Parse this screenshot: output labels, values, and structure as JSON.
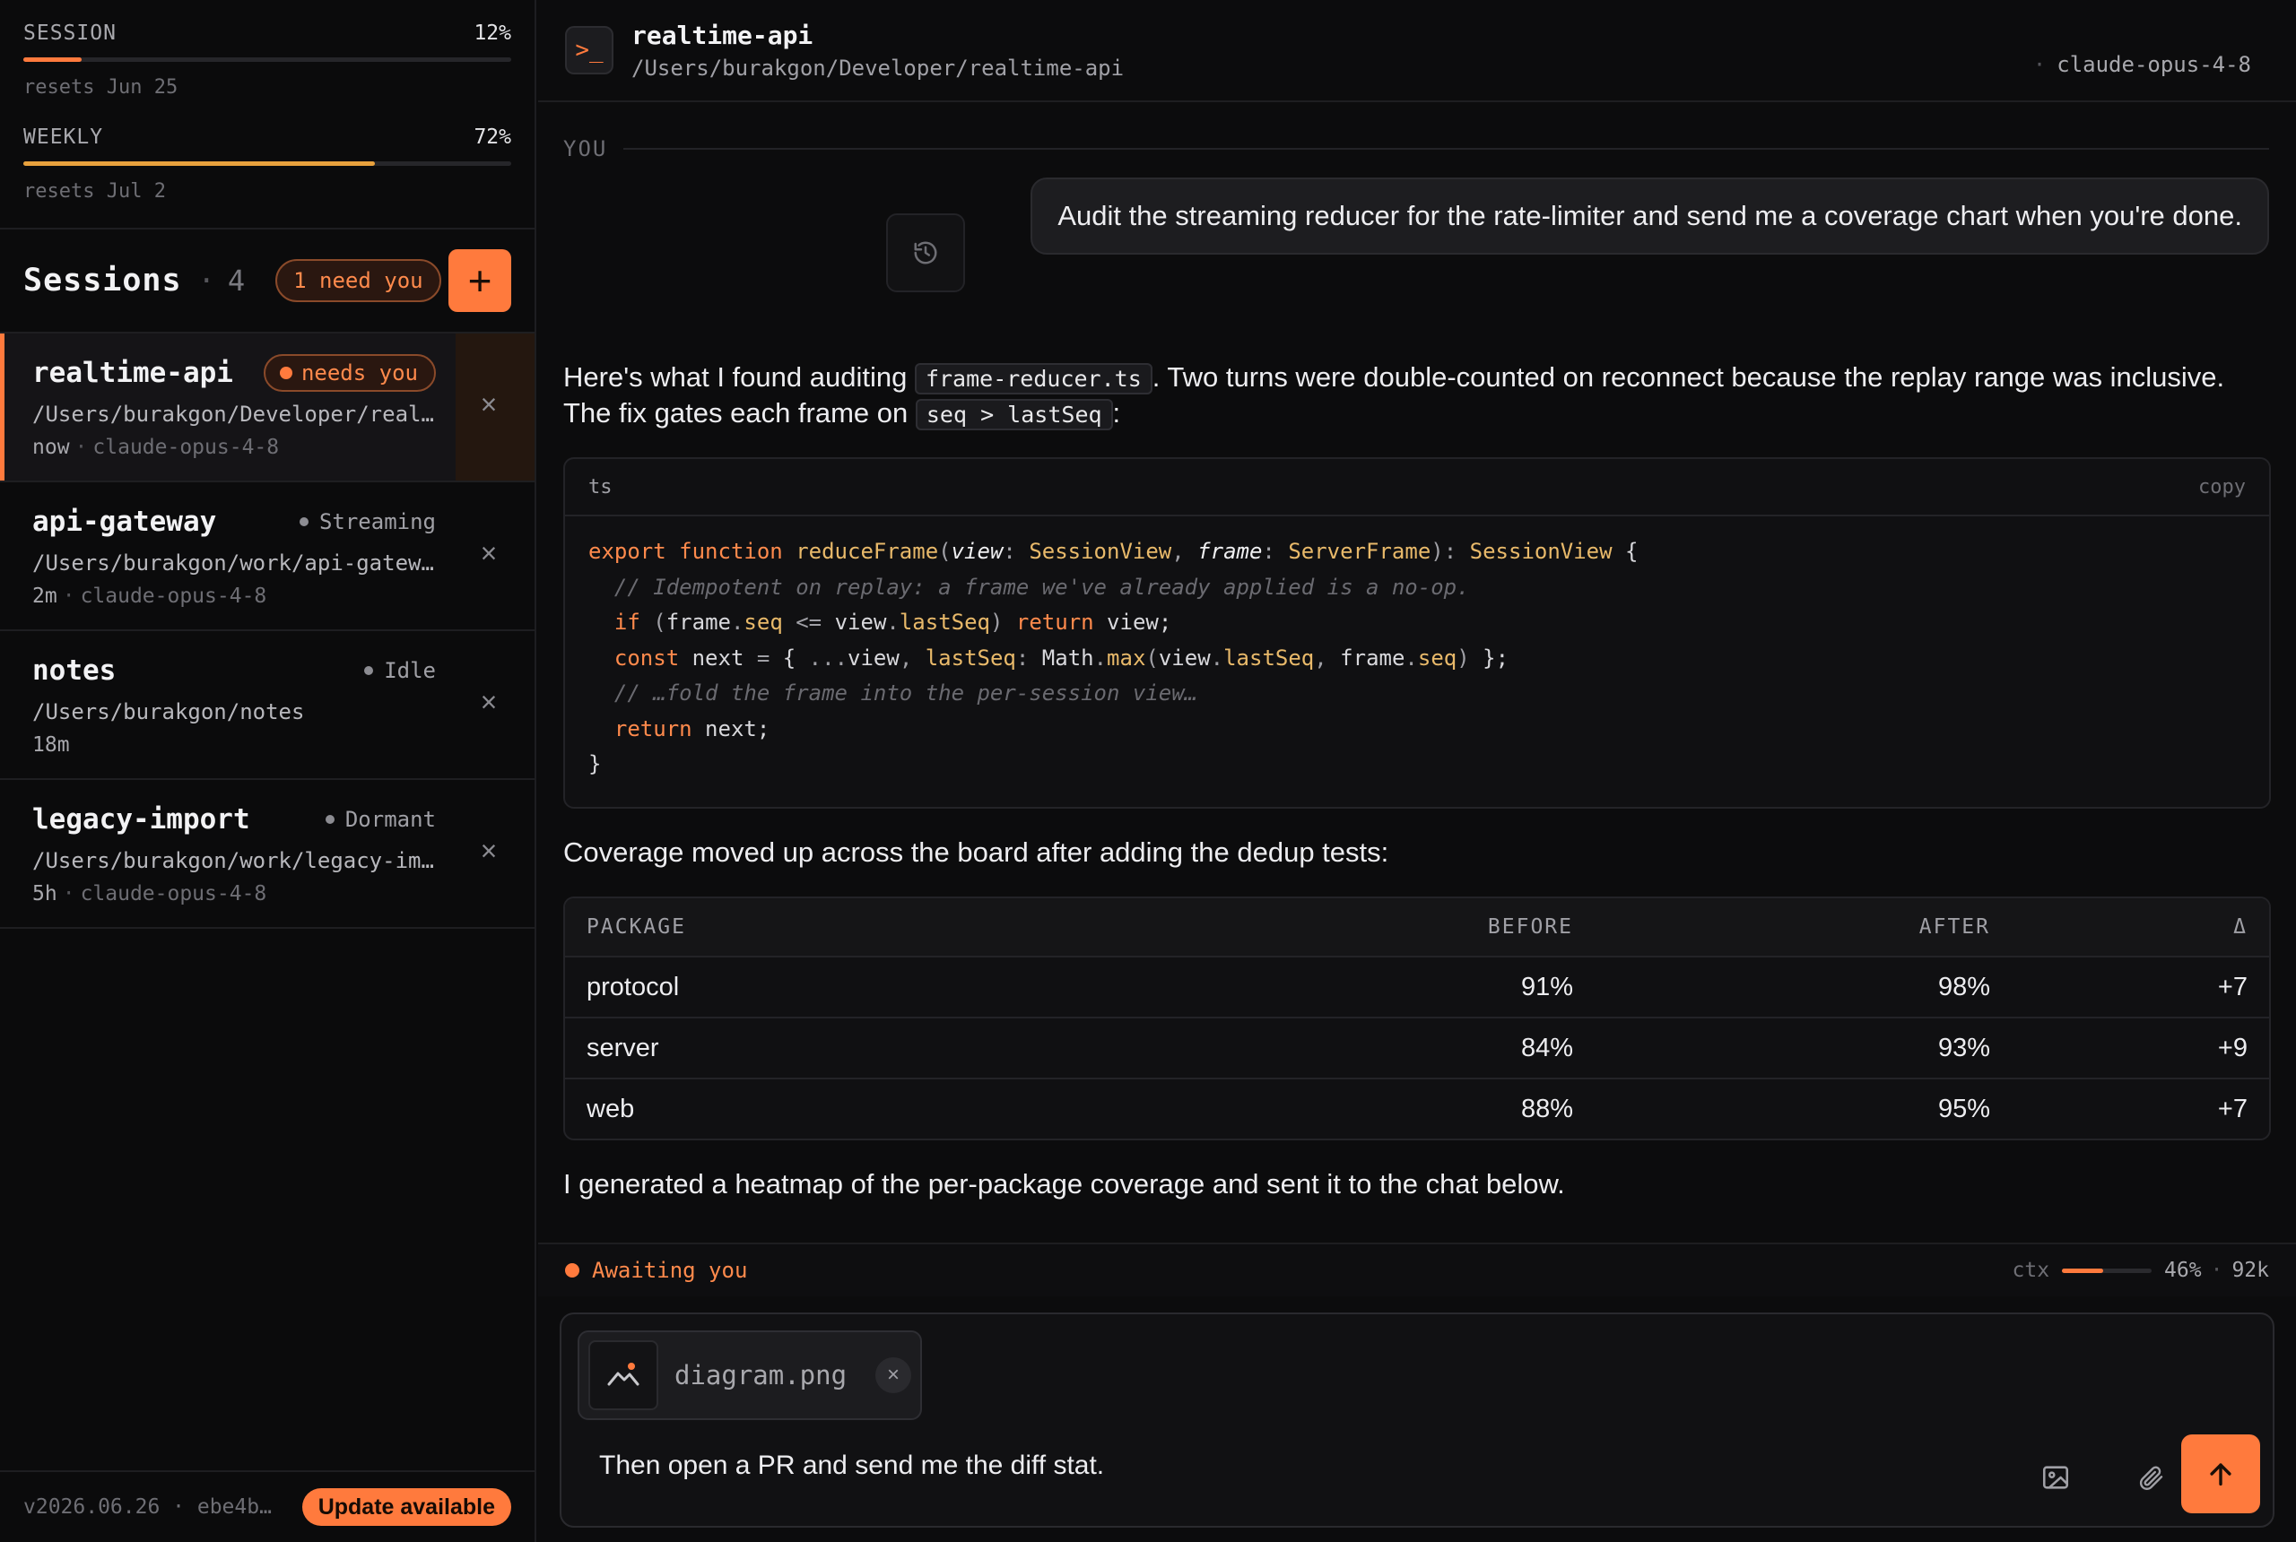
{
  "usage": {
    "session": {
      "label": "SESSION",
      "percent_label": "12%",
      "percent": 12,
      "reset": "resets Jun 25",
      "color": "#ff7a3d"
    },
    "weekly": {
      "label": "WEEKLY",
      "percent_label": "72%",
      "percent": 72,
      "reset": "resets Jul 2",
      "color": "#e8a13d"
    }
  },
  "sessions": {
    "title": "Sessions",
    "count": "4",
    "need_badge": "1 need you",
    "new_button_icon": "plus-icon",
    "items": [
      {
        "name": "realtime-api",
        "status": "needs you",
        "path": "/Users/burakgon/Developer/realtime-api",
        "time": "now",
        "model": "claude-opus-4-8",
        "active": true
      },
      {
        "name": "api-gateway",
        "status": "Streaming",
        "path": "/Users/burakgon/work/api-gateway",
        "time": "2m",
        "model": "claude-opus-4-8"
      },
      {
        "name": "notes",
        "status": "Idle",
        "path": "/Users/burakgon/notes",
        "time": "18m",
        "model": ""
      },
      {
        "name": "legacy-import",
        "status": "Dormant",
        "path": "/Users/burakgon/work/legacy-import",
        "time": "5h",
        "model": "claude-opus-4-8"
      }
    ]
  },
  "footer": {
    "version": "v2026.06.26 · ebe4b…",
    "update_label": "Update available"
  },
  "header": {
    "icon": "terminal-icon",
    "title": "realtime-api",
    "path": "/Users/burakgon/Developer/realtime-api",
    "model": "claude-opus-4-8"
  },
  "chat": {
    "you_label": "YOU",
    "user_message": "Audit the streaming reducer for the rate-limiter and send me a coverage chart when you're done.",
    "intro": {
      "t1": "Here's what I found auditing ",
      "code1": "frame-reducer.ts",
      "t2": ". Two turns were double-counted on reconnect because the replay range was inclusive. The fix gates each frame on ",
      "code2": "seq > lastSeq",
      "t3": ":"
    },
    "code": {
      "lang": "ts",
      "copy_label": "copy"
    },
    "coverage_intro": "Coverage moved up across the board after adding the dedup tests:",
    "table": {
      "headers": [
        "PACKAGE",
        "BEFORE",
        "AFTER",
        "Δ"
      ],
      "rows": [
        [
          "protocol",
          "91%",
          "98%",
          "+7"
        ],
        [
          "server",
          "84%",
          "93%",
          "+9"
        ],
        [
          "web",
          "88%",
          "95%",
          "+7"
        ]
      ]
    },
    "closing": "I generated a heatmap of the per-package coverage and sent it to the chat below."
  },
  "status": {
    "awaiting": "Awaiting you",
    "ctx_label": "ctx",
    "ctx_percent": 46,
    "ctx_percent_label": "46%",
    "ctx_tokens": "92k"
  },
  "composer": {
    "attachment": "diagram.png",
    "text": "Then open a PR and send me the diff stat.",
    "icons": [
      "image-icon",
      "paperclip-icon",
      "arrow-up-icon"
    ]
  },
  "colors": {
    "accent": "#ff7a3d",
    "weekly_bar": "#e8a13d"
  }
}
